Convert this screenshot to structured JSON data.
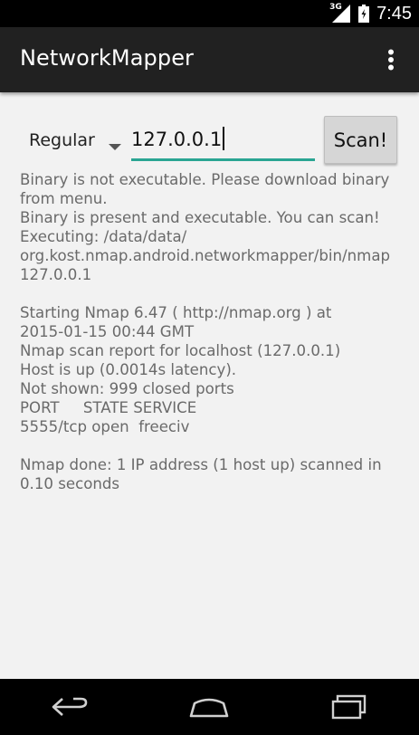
{
  "status_bar": {
    "network_type": "3G",
    "time": "7:45"
  },
  "action_bar": {
    "title": "NetworkMapper",
    "overflow_icon": "more-vert-icon"
  },
  "controls": {
    "scan_type_selected": "Regular",
    "target_value": "127.0.0.1",
    "scan_button_label": "Scan!",
    "accent_color": "#2aa593"
  },
  "output": {
    "lines": [
      "Binary is not executable. Please download binary",
      "from menu.",
      "Binary is present and executable. You can scan!",
      "Executing: /data/data/",
      "org.kost.nmap.android.networkmapper/bin/nmap",
      "127.0.0.1",
      "",
      "Starting Nmap 6.47 ( http://nmap.org ) at",
      "2015-01-15 00:44 GMT",
      "Nmap scan report for localhost (127.0.0.1)",
      "Host is up (0.0014s latency).",
      "Not shown: 999 closed ports",
      "PORT     STATE SERVICE",
      "5555/tcp open  freeciv",
      "",
      "Nmap done: 1 IP address (1 host up) scanned in",
      "0.10 seconds"
    ]
  },
  "nav_bar": {
    "back_icon": "back-icon",
    "home_icon": "home-icon",
    "recents_icon": "recents-icon"
  }
}
